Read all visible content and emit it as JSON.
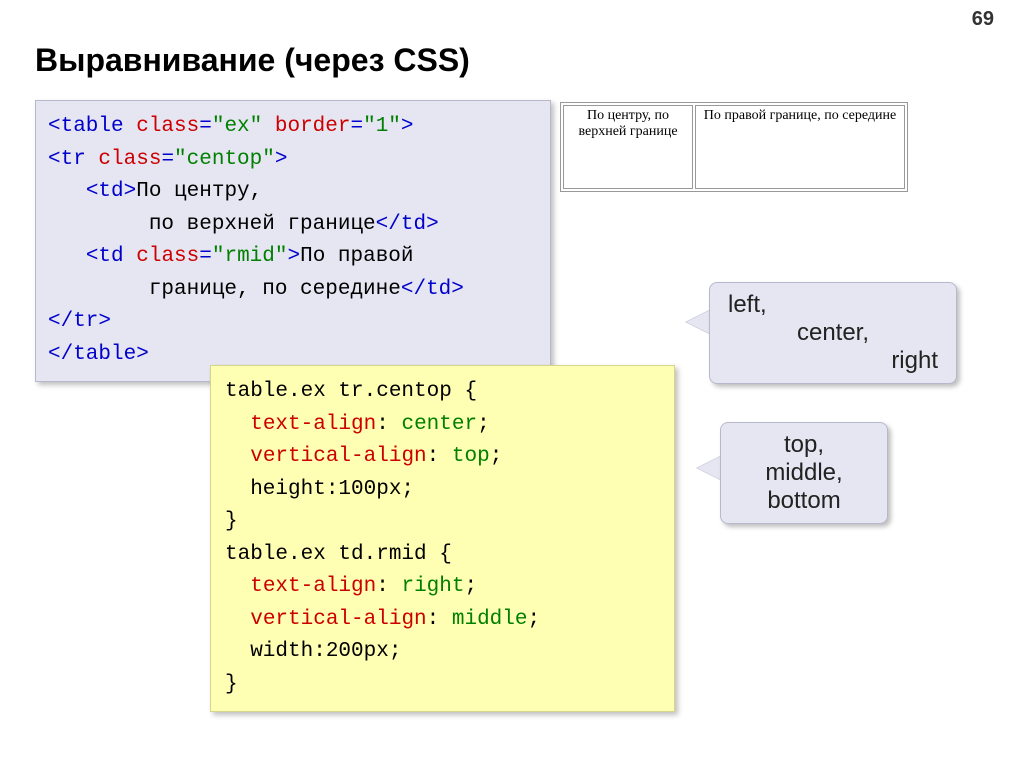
{
  "page_number": "69",
  "title": "Выравнивание (через CSS)",
  "html_code": {
    "l1_a": "<table ",
    "l1_b": "class",
    "l1_c": "=",
    "l1_d": "\"ex\"",
    "l1_e": " border",
    "l1_f": "=",
    "l1_g": "\"1\"",
    "l1_h": ">",
    "l2_a": "<tr ",
    "l2_b": "class",
    "l2_c": "=",
    "l2_d": "\"centop\"",
    "l2_e": ">",
    "l3_a": "   ",
    "l3_b": "<td>",
    "l3_c": "По центру,",
    "l4_a": "        по верхней границе",
    "l4_b": "</td>",
    "l5_a": "   ",
    "l5_b": "<td ",
    "l5_c": "class",
    "l5_d": "=",
    "l5_e": "\"rmid\"",
    "l5_f": ">",
    "l5_g": "По правой",
    "l6_a": "        границе, по середине",
    "l6_b": "</td>",
    "l7": "</tr>",
    "l8": "</table>"
  },
  "css_code": {
    "l1": "table.ex tr.centop {",
    "l2a": "  ",
    "l2b": "text-align",
    "l2c": ": ",
    "l2d": "center",
    "l2e": ";",
    "l3a": "  ",
    "l3b": "vertical-align",
    "l3c": ": ",
    "l3d": "top",
    "l3e": ";",
    "l4": "  height:100px;",
    "l5": "}",
    "l6": "table.ex td.rmid {",
    "l7a": "  ",
    "l7b": "text-align",
    "l7c": ": ",
    "l7d": "right",
    "l7e": ";",
    "l8a": "  ",
    "l8b": "vertical-align",
    "l8c": ": ",
    "l8d": "middle",
    "l8e": ";",
    "l9": "  width:200px;",
    "l10": "}"
  },
  "example": {
    "cell1": "По центру, по верхней границе",
    "cell2": "По правой границе, по середине"
  },
  "callout1": {
    "ln1": "left,",
    "ln2": "center,",
    "ln3": "right"
  },
  "callout2": {
    "ln1": "top,",
    "ln2": "middle,",
    "ln3": "bottom"
  }
}
